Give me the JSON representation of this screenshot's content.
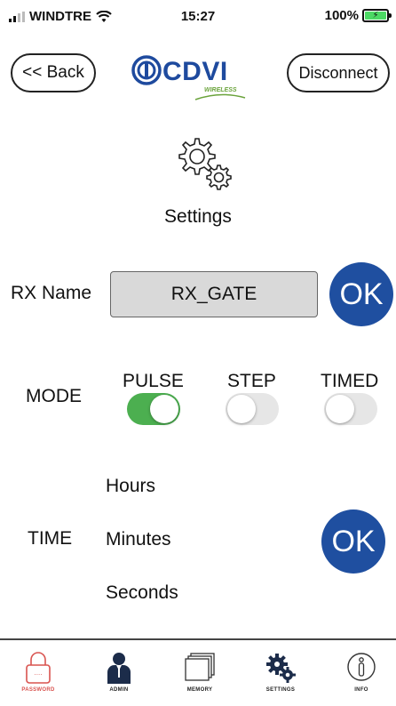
{
  "status_bar": {
    "carrier": "WINDTRE",
    "time": "15:27",
    "battery": "100%"
  },
  "header": {
    "back_label": "<< Back",
    "logo_text": "CDVI",
    "logo_subtext": "WIRELESS",
    "disconnect_label": "Disconnect"
  },
  "page": {
    "title": "Settings"
  },
  "rx": {
    "label": "RX Name",
    "value": "RX_GATE",
    "ok_label": "OK"
  },
  "mode": {
    "label": "MODE",
    "options": [
      {
        "label": "PULSE",
        "on": true
      },
      {
        "label": "STEP",
        "on": false
      },
      {
        "label": "TIMED",
        "on": false
      }
    ]
  },
  "time": {
    "label": "TIME",
    "fields": [
      "Hours",
      "Minutes",
      "Seconds"
    ],
    "ok_label": "OK"
  },
  "tabs": [
    {
      "label": "PASSWORD",
      "icon": "padlock-icon",
      "active": true
    },
    {
      "label": "ADMIN",
      "icon": "admin-user-icon",
      "active": false
    },
    {
      "label": "MEMORY",
      "icon": "memory-cards-icon",
      "active": false
    },
    {
      "label": "SETTINGS",
      "icon": "gears-icon",
      "active": false
    },
    {
      "label": "INFO",
      "icon": "info-icon",
      "active": false
    }
  ],
  "colors": {
    "accent": "#1f4fa0",
    "toggle_on": "#4caf50",
    "active_tab": "#d9534f"
  }
}
